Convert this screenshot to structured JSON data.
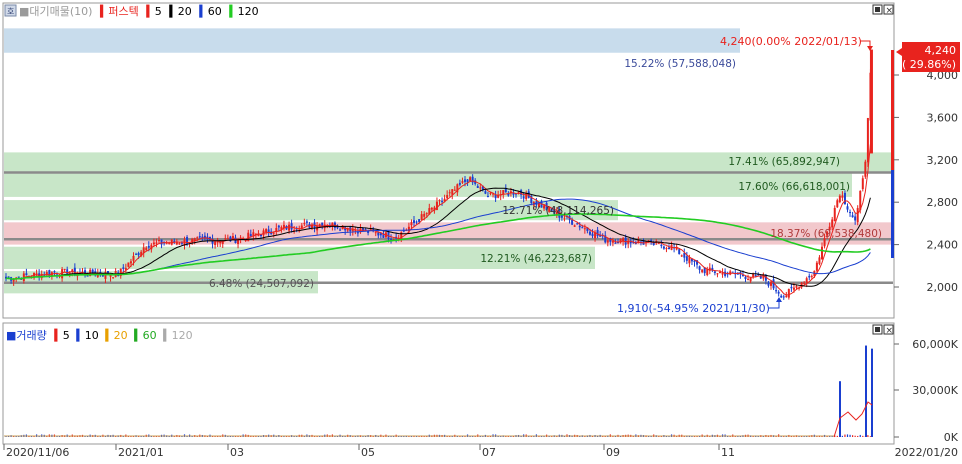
{
  "colors": {
    "up": "#e8231e",
    "down": "#1a3fd0",
    "ma5": "#e8231e",
    "ma20": "#000000",
    "ma60": "#1a3fd0",
    "ma120": "#22cc22",
    "price_label_bg": "#e8231e",
    "price_label_text": "#ffffff",
    "band_green": "#c8e6c8",
    "band_pink": "#f2c8cc",
    "band_blue": "#c8dcec"
  },
  "price_panel": {
    "legend": {
      "prefix": "■대기매물(10)",
      "name": "퍼스텍",
      "ma5": "5",
      "ma20": "20",
      "ma60": "60",
      "ma120": "120"
    },
    "current_price_label": "4,240",
    "current_change_label": "( 29.86%)",
    "y_ticks": [
      "4,000",
      "3,600",
      "3,200",
      "2,800",
      "2,400",
      "2,000"
    ],
    "annotations": {
      "high": "4,240(0.00% 2022/01/13)",
      "low": "1,910(-54.95% 2021/11/30)"
    },
    "volume_bands": [
      {
        "label": "15.22% (57,588,048)",
        "color": "blue"
      },
      {
        "label": "17.41% (65,892,947)",
        "color": "green"
      },
      {
        "label": "17.60% (66,618,001)",
        "color": "green"
      },
      {
        "label": "12.71% (48,114,265)",
        "color": "green"
      },
      {
        "label": "18.37% (69,538,480)",
        "color": "pink"
      },
      {
        "label": "12.21% (46,223,687)",
        "color": "green"
      },
      {
        "label": "6.48% (24,507,092)",
        "color": "green"
      }
    ]
  },
  "volume_panel": {
    "legend": {
      "prefix": "■거래량",
      "ma5": "5",
      "ma10": "10",
      "ma20": "20",
      "ma60": "60",
      "ma120": "120"
    },
    "y_ticks": [
      "60,000K",
      "30,000K",
      "0K"
    ]
  },
  "x_axis": {
    "labels": [
      "2020/11/06",
      "2021/01",
      "03",
      "05",
      "07",
      "09",
      "11",
      "2022/01/20"
    ]
  },
  "chart_data": {
    "type": "candlestick",
    "title": "퍼스텍",
    "xlabel": "",
    "ylabel": "",
    "x_range": [
      "2020/11/06",
      "2022/01/20"
    ],
    "ylim_price": [
      1900,
      4400
    ],
    "ylim_volume_k": [
      0,
      65000
    ],
    "price_path": [
      {
        "date": "2020/11/06",
        "close": 2080
      },
      {
        "date": "2020/12/01",
        "close": 2140
      },
      {
        "date": "2021/01/01",
        "close": 2120
      },
      {
        "date": "2021/01/15",
        "close": 2400
      },
      {
        "date": "2021/02/01",
        "close": 2430
      },
      {
        "date": "2021/03/01",
        "close": 2450
      },
      {
        "date": "2021/03/25",
        "close": 2560
      },
      {
        "date": "2021/04/15",
        "close": 2600
      },
      {
        "date": "2021/05/01",
        "close": 2540
      },
      {
        "date": "2021/05/20",
        "close": 2470
      },
      {
        "date": "2021/06/10",
        "close": 2780
      },
      {
        "date": "2021/06/25",
        "close": 3020
      },
      {
        "date": "2021/07/05",
        "close": 2860
      },
      {
        "date": "2021/07/20",
        "close": 2900
      },
      {
        "date": "2021/08/05",
        "close": 2720
      },
      {
        "date": "2021/08/20",
        "close": 2580
      },
      {
        "date": "2021/09/01",
        "close": 2450
      },
      {
        "date": "2021/09/20",
        "close": 2420
      },
      {
        "date": "2021/10/05",
        "close": 2380
      },
      {
        "date": "2021/10/20",
        "close": 2160
      },
      {
        "date": "2021/11/05",
        "close": 2120
      },
      {
        "date": "2021/11/20",
        "close": 2080
      },
      {
        "date": "2021/11/30",
        "close": 1910
      },
      {
        "date": "2021/12/15",
        "close": 2140
      },
      {
        "date": "2021/12/28",
        "close": 2900
      },
      {
        "date": "2022/01/05",
        "close": 2600
      },
      {
        "date": "2022/01/10",
        "close": 3260
      },
      {
        "date": "2022/01/13",
        "close": 4240
      }
    ],
    "moving_averages": [
      "5",
      "20",
      "60",
      "120"
    ],
    "volume_spikes_k": [
      {
        "date": "2021/12/28",
        "value": 36000
      },
      {
        "date": "2022/01/10",
        "value": 59000
      },
      {
        "date": "2022/01/13",
        "value": 57000
      }
    ]
  }
}
